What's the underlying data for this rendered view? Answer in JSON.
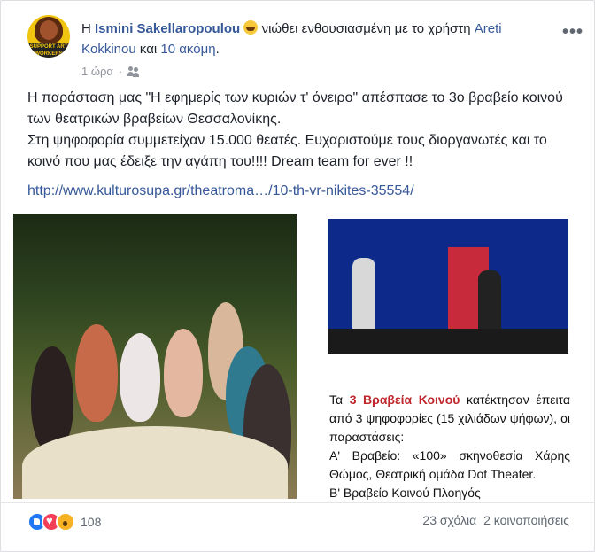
{
  "post": {
    "prefix": "Η",
    "author": "Ismini Sakellaropoulou",
    "feeling_text": "νιώθει ενθουσιασμένη με το χρήστη",
    "tagged_user": "Areti Kokkinou",
    "and_text": "και",
    "others_link": "10 ακόμη",
    "timestamp": "1 ώρα",
    "audience_icon": "friends-icon",
    "menu_label": "•••",
    "avatar_text": "SUPPORT ART WORKERS",
    "body_lines": [
      "Η παράσταση μας \"Η εφημερίς των κυριών τ' όνειρο\" απέσπασε το 3ο βραβείο κοινού των θεατρικών βραβείων Θεσσαλονίκης.",
      "Στη ψηφοφορία συμμετείχαν 15.000 θεατές. Ευχαριστούμε τους διοργανωτές και το κοινό που μας έδειξε την αγάπη του!!!! Dream team for ever !!"
    ],
    "url": "http://www.kulturosupa.gr/theatroma…/10-th-vr-nikites-35554/"
  },
  "shared_image": {
    "caption_lines": [
      {
        "pre": "Τα ",
        "red": "3 Βραβεία Κοινού",
        "post": " κατέκτησαν έπειτα από 3 ψηφοφορίες (15 χιλιάδων ψήφων), οι παραστάσεις:"
      },
      {
        "pre": "Α' Βραβείο: «100» σκηνοθεσία Χάρης Θώμος, Θεατρική ομάδα Dot Theater.",
        "red": "",
        "post": ""
      },
      {
        "pre": "Β' Βραβείο Κοινού Πλοηγός",
        "red": "",
        "post": ""
      }
    ]
  },
  "footer": {
    "reactions": [
      "like-icon",
      "love-icon",
      "wow-icon"
    ],
    "reaction_count": "108",
    "comments": "23 σχόλια",
    "shares": "2 κοινοποιήσεις"
  }
}
